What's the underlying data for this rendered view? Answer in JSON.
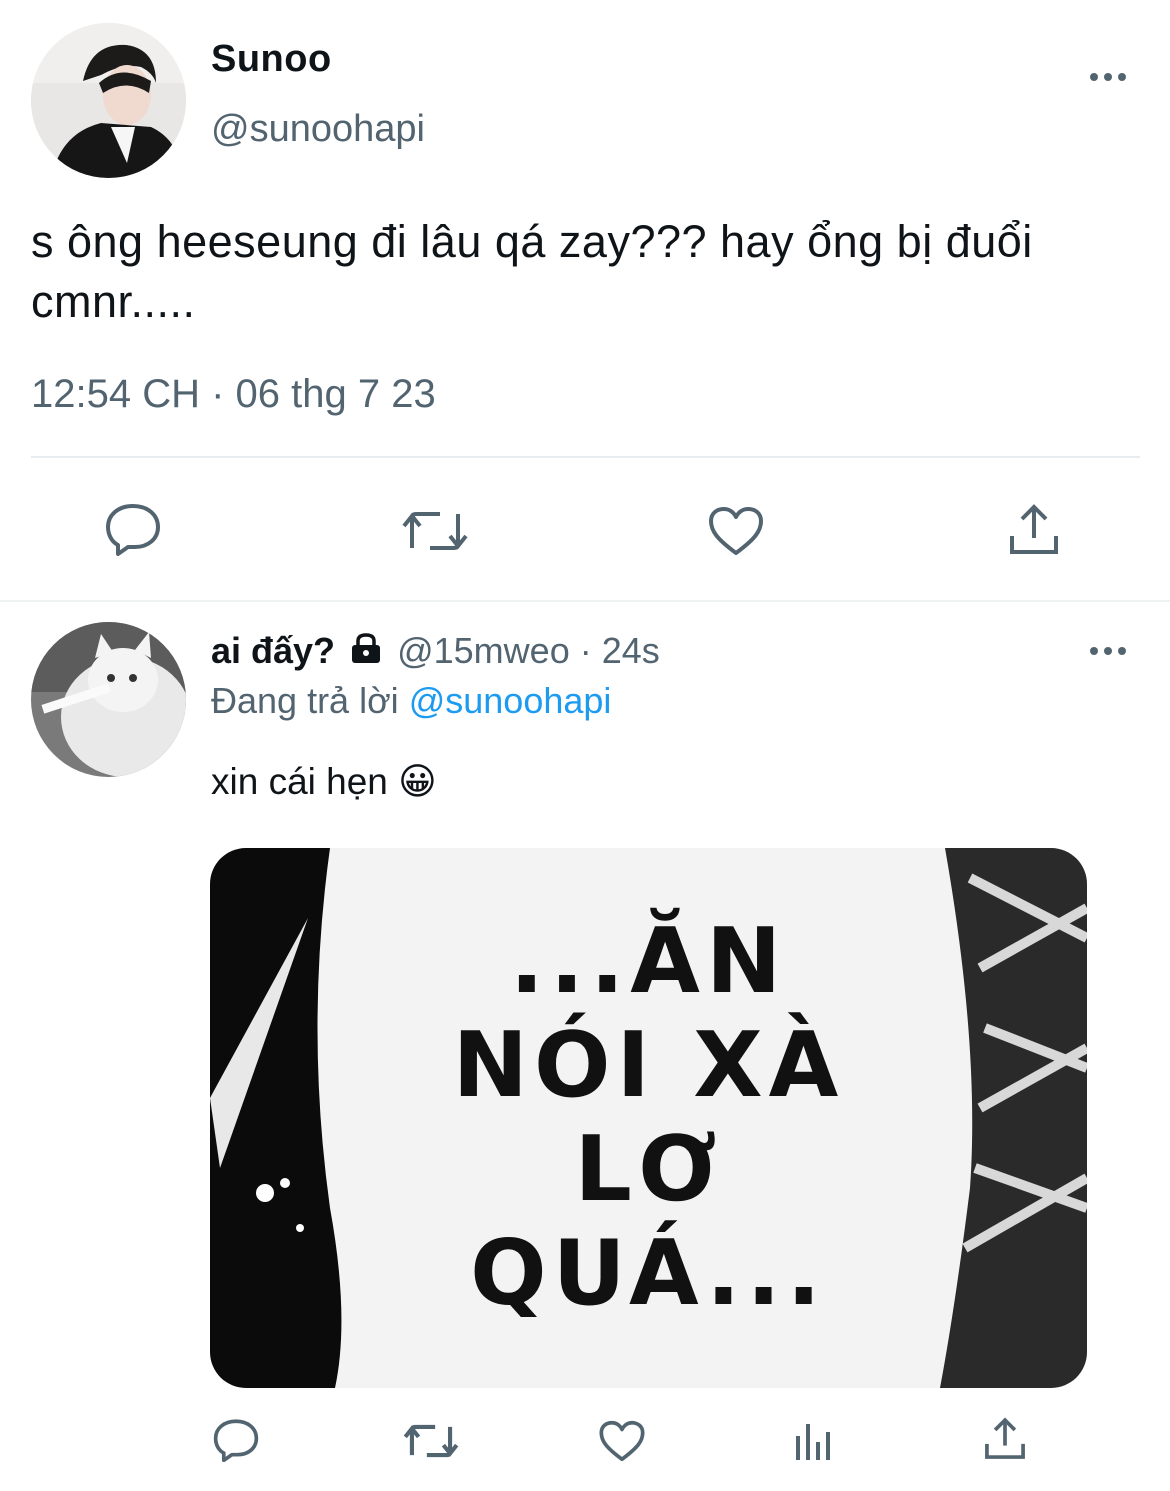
{
  "tweet": {
    "author_name": "Sunoo",
    "author_handle": "@sunoohapi",
    "more_icon": "more-icon",
    "text": "s ông heeseung đi lâu qá zay??? hay ổng bị đuổi cmnr.....",
    "timestamp": "12:54 CH · 06 thg 7 23",
    "actions": [
      "reply-icon",
      "retweet-icon",
      "like-icon",
      "share-icon"
    ]
  },
  "reply": {
    "author_name": "ai đấy?",
    "lock_icon": "lock-icon",
    "author_handle": "@15mweo",
    "age": "· 24s",
    "replying_prefix": "Đang trả lời",
    "replying_to": "@sunoohapi",
    "text": "xin cái hẹn 😀",
    "media_text": "...ĂN NÓI XÀ LƠ QUÁ...",
    "actions": [
      "reply-icon",
      "retweet-icon",
      "like-icon",
      "analytics-icon",
      "share-icon"
    ]
  },
  "colors": {
    "text": "#0f1419",
    "muted": "#536471",
    "link": "#1d9bf0",
    "divider": "#e6ecf0"
  }
}
